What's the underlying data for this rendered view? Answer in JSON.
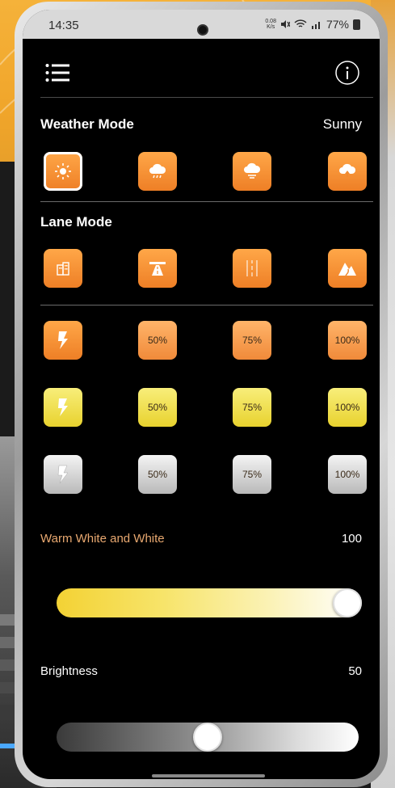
{
  "status_bar": {
    "time": "14:35",
    "net_speed_top": "0.08",
    "net_speed_bottom": "K/s",
    "battery": "77%"
  },
  "toolbar": {
    "menu_icon": "hamburger-menu-icon",
    "info_icon": "info-icon"
  },
  "weather_mode": {
    "label": "Weather Mode",
    "value": "Sunny",
    "options": [
      {
        "icon": "sun-icon",
        "selected": true
      },
      {
        "icon": "rain-cloud-icon",
        "selected": false
      },
      {
        "icon": "fog-cloud-icon",
        "selected": false
      },
      {
        "icon": "snow-cloud-icon",
        "selected": false
      }
    ]
  },
  "lane_mode": {
    "label": "Lane Mode",
    "options": [
      {
        "icon": "city-building-icon"
      },
      {
        "icon": "highway-icon"
      },
      {
        "icon": "lane-lines-icon"
      },
      {
        "icon": "mountain-road-icon"
      }
    ]
  },
  "color_presets": [
    {
      "color": "orange",
      "flash_icon": "flash-icon",
      "levels": [
        "50%",
        "75%",
        "100%"
      ]
    },
    {
      "color": "yellow",
      "flash_icon": "flash-icon",
      "levels": [
        "50%",
        "75%",
        "100%"
      ]
    },
    {
      "color": "white",
      "flash_icon": "flash-icon",
      "levels": [
        "50%",
        "75%",
        "100%"
      ]
    }
  ],
  "warm_white": {
    "label": "Warm White and White",
    "value": "100",
    "label_color": "#e8a870",
    "fraction": 1.0
  },
  "brightness": {
    "label": "Brightness",
    "value": "50",
    "fraction": 0.5
  }
}
